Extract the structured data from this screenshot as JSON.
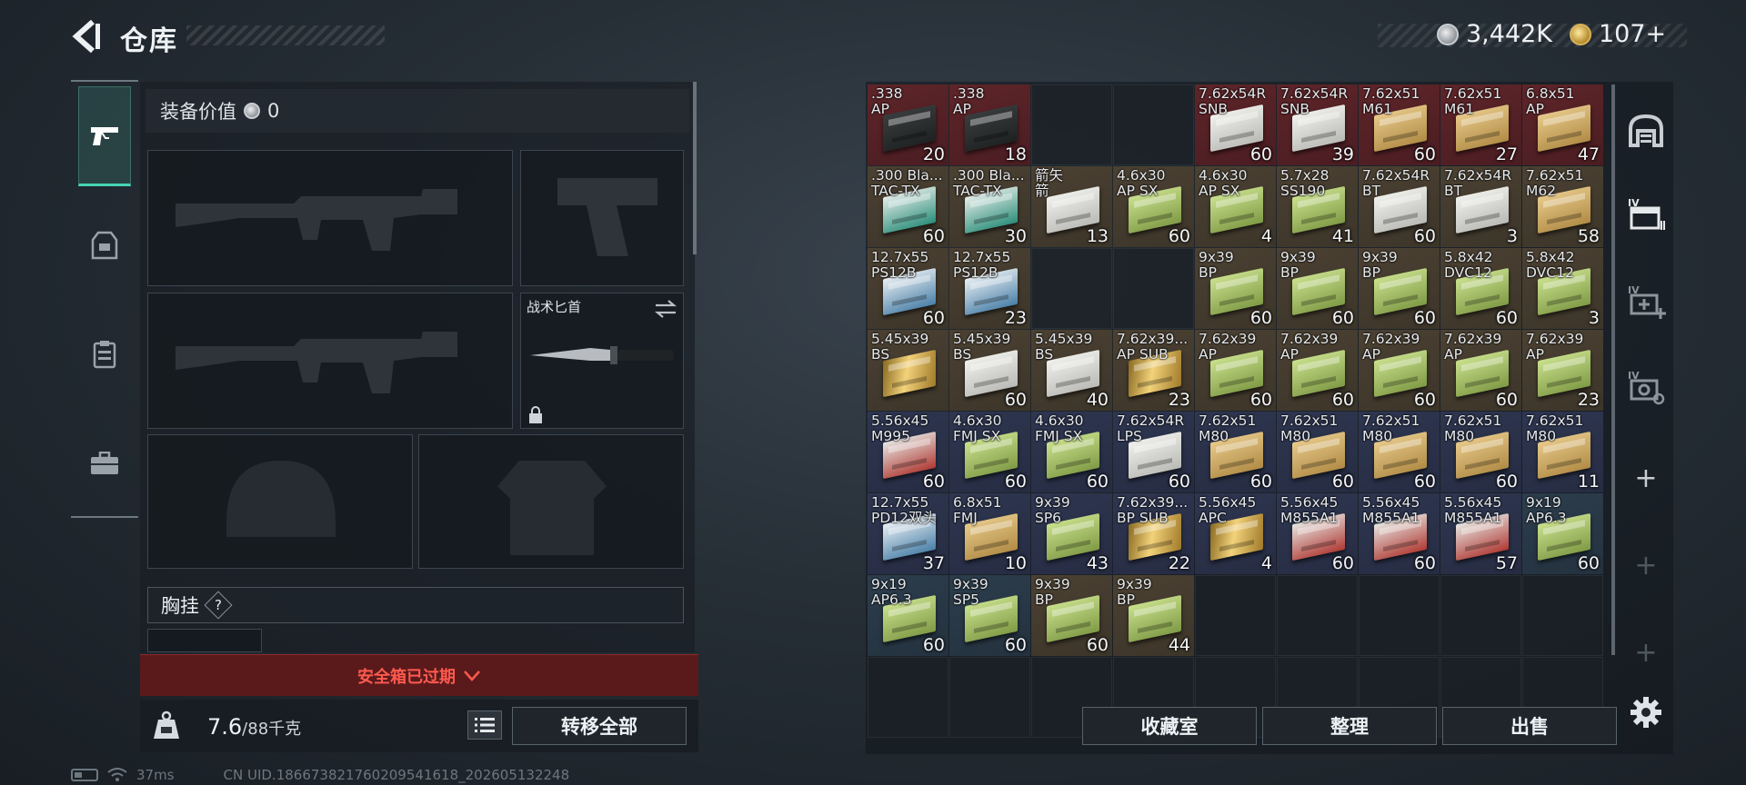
{
  "header": {
    "title": "仓库",
    "currency_silver": "3,442K",
    "currency_gold": "107+"
  },
  "equipment": {
    "value_label": "装备价值",
    "value": "0",
    "knife_label": "战术匕首",
    "chest_label": "胸挂",
    "chest_help": "?",
    "safe_box_status": "安全箱已过期",
    "weight": "7.6",
    "weight_max": "/88千克",
    "transfer_all": "转移全部"
  },
  "status_bar": {
    "ping": "37ms",
    "uid": "CN UID.1866738217602095416​18_202605132248"
  },
  "warehouse": {
    "buttons": {
      "collection": "收藏室",
      "organize": "整理",
      "sell": "出售"
    },
    "items": [
      {
        "name": ".338\nAP",
        "qty": "20",
        "bg": "red",
        "box": "dark"
      },
      {
        "name": ".338\nAP",
        "qty": "18",
        "bg": "red",
        "box": "dark"
      },
      null,
      null,
      {
        "name": "7.62x54R\nSNB",
        "qty": "60",
        "bg": "red",
        "box": "white"
      },
      {
        "name": "7.62x54R\nSNB",
        "qty": "39",
        "bg": "red",
        "box": "white"
      },
      {
        "name": "7.62x51\nM61",
        "qty": "60",
        "bg": "red",
        "box": "tan"
      },
      {
        "name": "7.62x51\nM61",
        "qty": "27",
        "bg": "red",
        "box": "tan"
      },
      {
        "name": "6.8x51\nAP",
        "qty": "47",
        "bg": "red",
        "box": "tan"
      },
      {
        "name": ".300 Bla...\nTAC-TX",
        "qty": "60",
        "bg": "brown",
        "box": "teal"
      },
      {
        "name": ".300 Bla...\nTAC-TX",
        "qty": "30",
        "bg": "brown",
        "box": "teal"
      },
      {
        "name": "箭矢\n箭",
        "qty": "13",
        "bg": "brown",
        "box": "white"
      },
      {
        "name": "4.6x30\nAP SX",
        "qty": "60",
        "bg": "brown",
        "box": "green"
      },
      {
        "name": "4.6x30\nAP SX",
        "qty": "4",
        "bg": "brown",
        "box": "green"
      },
      {
        "name": "5.7x28\nSS190",
        "qty": "41",
        "bg": "brown",
        "box": "green"
      },
      {
        "name": "7.62x54R\nBT",
        "qty": "60",
        "bg": "brown",
        "box": "white"
      },
      {
        "name": "7.62x54R\nBT",
        "qty": "3",
        "bg": "brown",
        "box": "white"
      },
      {
        "name": "7.62x51\nM62",
        "qty": "58",
        "bg": "brown",
        "box": "tan"
      },
      {
        "name": "12.7x55\nPS12B",
        "qty": "60",
        "bg": "brown",
        "box": "blue"
      },
      {
        "name": "12.7x55\nPS12B",
        "qty": "23",
        "bg": "brown",
        "box": "blue"
      },
      null,
      null,
      {
        "name": "9x39\nBP",
        "qty": "60",
        "bg": "brown",
        "box": "green"
      },
      {
        "name": "9x39\nBP",
        "qty": "60",
        "bg": "brown",
        "box": "green"
      },
      {
        "name": "9x39\nBP",
        "qty": "60",
        "bg": "brown",
        "box": "green"
      },
      {
        "name": "5.8x42\nDVC12",
        "qty": "60",
        "bg": "brown",
        "box": "green"
      },
      {
        "name": "5.8x42\nDVC12",
        "qty": "3",
        "bg": "brown",
        "box": "green"
      },
      {
        "name": "5.45x39\nBS",
        "qty": "",
        "bg": "brown",
        "box": "bullet"
      },
      {
        "name": "5.45x39\nBS",
        "qty": "60",
        "bg": "brown",
        "box": "white"
      },
      {
        "name": "5.45x39\nBS",
        "qty": "40",
        "bg": "brown",
        "box": "white"
      },
      {
        "name": "7.62x39...\nAP SUB",
        "qty": "23",
        "bg": "brown",
        "box": "bullet"
      },
      {
        "name": "7.62x39\nAP",
        "qty": "60",
        "bg": "brown",
        "box": "green"
      },
      {
        "name": "7.62x39\nAP",
        "qty": "60",
        "bg": "brown",
        "box": "green"
      },
      {
        "name": "7.62x39\nAP",
        "qty": "60",
        "bg": "brown",
        "box": "green"
      },
      {
        "name": "7.62x39\nAP",
        "qty": "60",
        "bg": "brown",
        "box": "green"
      },
      {
        "name": "7.62x39\nAP",
        "qty": "23",
        "bg": "brown",
        "box": "green"
      },
      {
        "name": "5.56x45\nM995",
        "qty": "60",
        "bg": "blue",
        "box": "red"
      },
      {
        "name": "4.6x30\nFMJ SX",
        "qty": "60",
        "bg": "blue",
        "box": "green"
      },
      {
        "name": "4.6x30\nFMJ SX",
        "qty": "60",
        "bg": "blue",
        "box": "green"
      },
      {
        "name": "7.62x54R\nLPS",
        "qty": "60",
        "bg": "blue",
        "box": "white"
      },
      {
        "name": "7.62x51\nM80",
        "qty": "60",
        "bg": "blue",
        "box": "tan"
      },
      {
        "name": "7.62x51\nM80",
        "qty": "60",
        "bg": "blue",
        "box": "tan"
      },
      {
        "name": "7.62x51\nM80",
        "qty": "60",
        "bg": "blue",
        "box": "tan"
      },
      {
        "name": "7.62x51\nM80",
        "qty": "60",
        "bg": "blue",
        "box": "tan"
      },
      {
        "name": "7.62x51\nM80",
        "qty": "11",
        "bg": "blue",
        "box": "tan"
      },
      {
        "name": "12.7x55\nPD12双头",
        "qty": "37",
        "bg": "blue",
        "box": "blue"
      },
      {
        "name": "6.8x51\nFMJ",
        "qty": "10",
        "bg": "blue",
        "box": "tan"
      },
      {
        "name": "9x39\nSP6",
        "qty": "43",
        "bg": "blue",
        "box": "green"
      },
      {
        "name": "7.62x39...\nBP SUB",
        "qty": "22",
        "bg": "blue",
        "box": "bullet"
      },
      {
        "name": "5.56x45\nAPC",
        "qty": "4",
        "bg": "blue",
        "box": "bullet"
      },
      {
        "name": "5.56x45\nM855A1",
        "qty": "60",
        "bg": "blue",
        "box": "red"
      },
      {
        "name": "5.56x45\nM855A1",
        "qty": "60",
        "bg": "blue",
        "box": "red"
      },
      {
        "name": "5.56x45\nM855A1",
        "qty": "57",
        "bg": "blue",
        "box": "red"
      },
      {
        "name": "9x19\nAP6.3",
        "qty": "60",
        "bg": "steel",
        "box": "green"
      },
      {
        "name": "9x19\nAP6.3",
        "qty": "60",
        "bg": "steel",
        "box": "green"
      },
      {
        "name": "9x39\nSP5",
        "qty": "60",
        "bg": "steel",
        "box": "green"
      },
      {
        "name": "9x39\nBP",
        "qty": "60",
        "bg": "brown",
        "box": "green"
      },
      {
        "name": "9x39\nBP",
        "qty": "44",
        "bg": "brown",
        "box": "green"
      }
    ]
  }
}
